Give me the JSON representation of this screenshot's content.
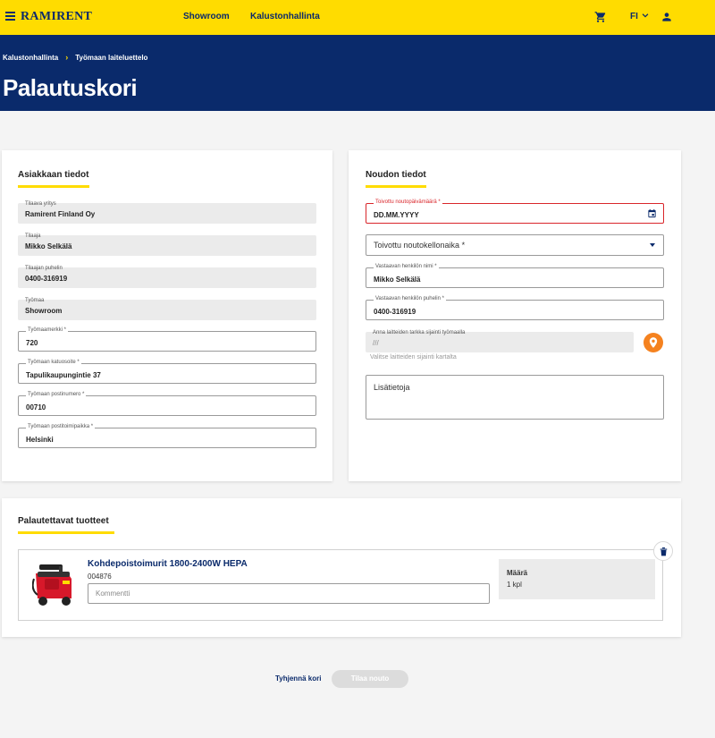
{
  "header": {
    "logo": "RAMIRENT",
    "nav": [
      "Showroom",
      "Kalustonhallinta"
    ],
    "language": "FI",
    "brand_color": "#ffdc00",
    "navy": "#0a2a6b"
  },
  "hero": {
    "breadcrumb": [
      "Kalustonhallinta",
      "Työmaan laiteluettelo"
    ],
    "title": "Palautuskori"
  },
  "customer": {
    "title": "Asiakkaan tiedot",
    "fields": [
      {
        "label": "Tilaava yritys",
        "value": "Ramirent Finland Oy"
      },
      {
        "label": "Tilaaja",
        "value": "Mikko Selkälä"
      },
      {
        "label": "Tilaajan puhelin",
        "value": "0400-316919"
      },
      {
        "label": "Työmaa",
        "value": "Showroom"
      },
      {
        "label": "Työmaamerkki *",
        "value": "720"
      },
      {
        "label": "Työmaan katuosoite *",
        "value": "Tapulikaupungintie 37"
      },
      {
        "label": "Työmaan postinumero *",
        "value": "00710"
      },
      {
        "label": "Työmaan postitoimipaikka *",
        "value": "Helsinki"
      }
    ]
  },
  "pickup": {
    "title": "Noudon tiedot",
    "date": {
      "label": "Toivottu noutopäivämäärä *",
      "placeholder": "DD.MM.YYYY"
    },
    "time": {
      "placeholder": "Toivottu noutokellonaika *"
    },
    "contact_name": {
      "label": "Vastaavan henkilön nimi *",
      "value": "Mikko Selkälä"
    },
    "contact_phone": {
      "label": "Vastaavan henkilön puhelin *",
      "value": "0400-316919"
    },
    "location": {
      "label": "Anna laitteiden tarkka sijainti työmaalla",
      "value": "///",
      "helper": "Valitse laitteiden sijainti kartalta"
    },
    "notes": {
      "placeholder": "Lisätietoja"
    }
  },
  "products": {
    "title": "Palautettavat tuotteet",
    "items": [
      {
        "name": "Kohdepoistoimurit 1800-2400W HEPA",
        "code": "004876",
        "comment_placeholder": "Kommentti",
        "qty_label": "Määrä",
        "qty_value": "1 kpl"
      }
    ]
  },
  "actions": {
    "clear": "Tyhjennä kori",
    "order": "Tilaa nouto"
  }
}
